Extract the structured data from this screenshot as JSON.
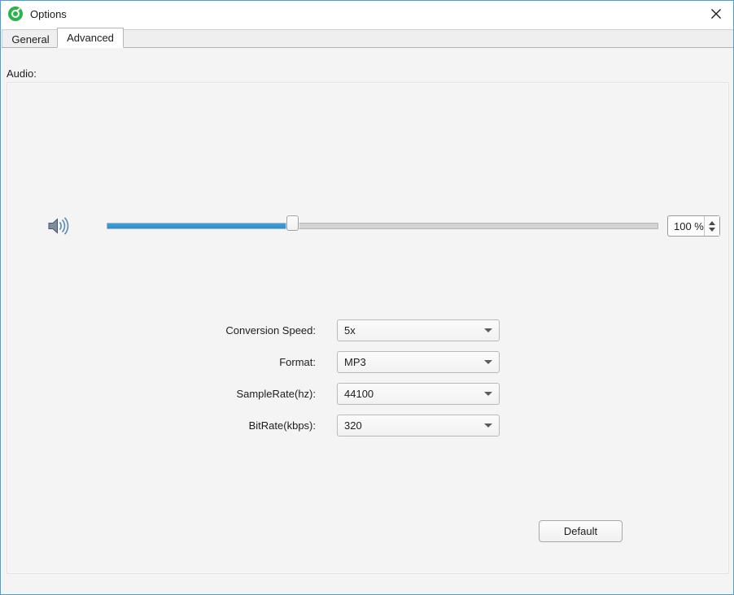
{
  "window": {
    "title": "Options",
    "app_icon": "target-green-icon",
    "close_label": "✕",
    "border_color": "#4a9fd4"
  },
  "tabs": [
    {
      "id": "general",
      "label": "General",
      "active": false
    },
    {
      "id": "advanced",
      "label": "Advanced",
      "active": true
    }
  ],
  "advanced": {
    "group_label": "Audio:",
    "volume": {
      "icon": "speaker-icon",
      "value": 100,
      "display": "100 %",
      "unit": "%",
      "slider_percent": 34,
      "fill_color": "#2e9fe0",
      "track_color": "#d3d3d3",
      "spin_up_label": "▲",
      "spin_down_label": "▼"
    },
    "fields": [
      {
        "id": "conversion-speed",
        "label": "Conversion Speed:",
        "value": "5x"
      },
      {
        "id": "format",
        "label": "Format:",
        "value": "MP3"
      },
      {
        "id": "samplerate",
        "label": "SampleRate(hz):",
        "value": "44100"
      },
      {
        "id": "bitrate",
        "label": "BitRate(kbps):",
        "value": "320"
      }
    ],
    "default_button": "Default"
  }
}
